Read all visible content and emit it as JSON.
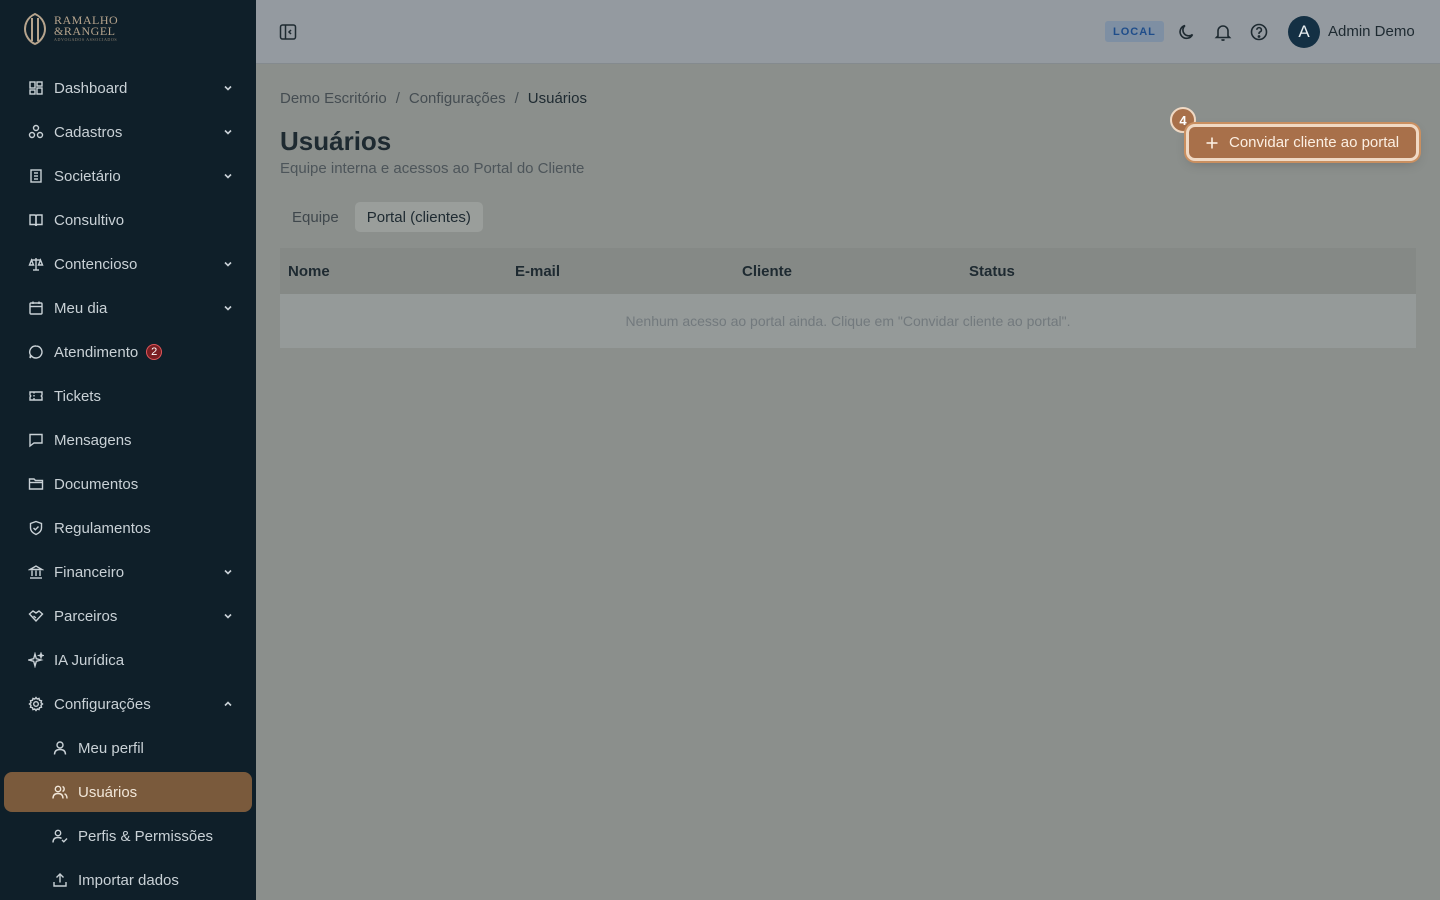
{
  "brand": {
    "line1": "RAMALHO",
    "line2": "&RANGEL",
    "line3": "ADVOGADOS ASSOCIADOS",
    "accent": "#a8704a"
  },
  "sidebar": {
    "items": [
      {
        "label": "Dashboard",
        "icon": "dashboard-icon",
        "expandable": true
      },
      {
        "label": "Cadastros",
        "icon": "cadastros-icon",
        "expandable": true
      },
      {
        "label": "Societário",
        "icon": "building-icon",
        "expandable": true
      },
      {
        "label": "Consultivo",
        "icon": "book-icon",
        "expandable": false
      },
      {
        "label": "Contencioso",
        "icon": "scale-icon",
        "expandable": true
      },
      {
        "label": "Meu dia",
        "icon": "calendar-icon",
        "expandable": true
      },
      {
        "label": "Atendimento",
        "icon": "chat-icon",
        "expandable": false,
        "badge": "2"
      },
      {
        "label": "Tickets",
        "icon": "ticket-icon",
        "expandable": false
      },
      {
        "label": "Mensagens",
        "icon": "message-icon",
        "expandable": false
      },
      {
        "label": "Documentos",
        "icon": "folder-icon",
        "expandable": false
      },
      {
        "label": "Regulamentos",
        "icon": "shield-icon",
        "expandable": false
      },
      {
        "label": "Financeiro",
        "icon": "bank-icon",
        "expandable": true
      },
      {
        "label": "Parceiros",
        "icon": "handshake-icon",
        "expandable": true
      },
      {
        "label": "IA Jurídica",
        "icon": "sparkles-icon",
        "expandable": false
      },
      {
        "label": "Configurações",
        "icon": "gear-icon",
        "expandable": true,
        "expanded": true
      }
    ],
    "sub_items": [
      {
        "label": "Meu perfil",
        "icon": "user-icon"
      },
      {
        "label": "Usuários",
        "icon": "users-icon",
        "active": true
      },
      {
        "label": "Perfis & Permissões",
        "icon": "user-check-icon"
      },
      {
        "label": "Importar dados",
        "icon": "upload-icon"
      }
    ]
  },
  "header": {
    "env_badge": "LOCAL",
    "avatar_initial": "A",
    "user_name": "Admin Demo"
  },
  "breadcrumb": [
    "Demo Escritório",
    "Configurações",
    "Usuários"
  ],
  "page": {
    "title": "Usuários",
    "subtitle": "Equipe interna e acessos ao Portal do Cliente",
    "tabs": [
      {
        "label": "Equipe",
        "active": false
      },
      {
        "label": "Portal (clientes)",
        "active": true
      }
    ],
    "table": {
      "columns": [
        "Nome",
        "E-mail",
        "Cliente",
        "Status"
      ],
      "empty_message": "Nenhum acesso ao portal ainda. Clique em \"Convidar cliente ao portal\"."
    },
    "cta_label": "Convidar cliente ao portal",
    "tour_step": "4"
  }
}
